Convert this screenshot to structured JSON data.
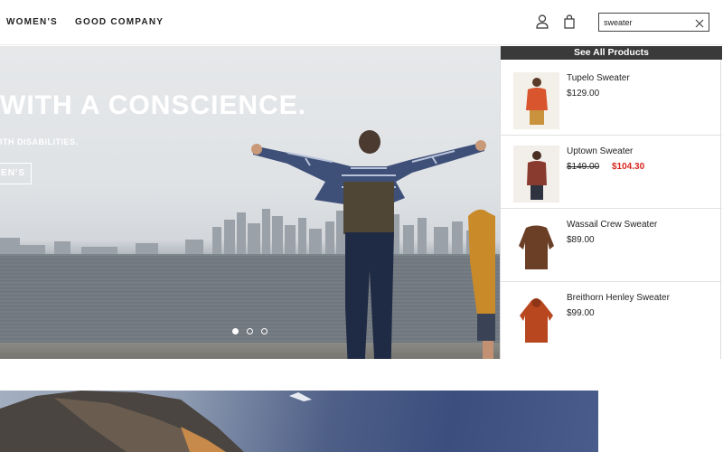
{
  "header": {
    "nav": [
      "WOMEN'S",
      "GOOD COMPANY"
    ],
    "search": {
      "value": "sweater",
      "placeholder": ""
    },
    "icons": [
      "user-icon",
      "shopping-bag-icon",
      "close-icon"
    ]
  },
  "hero": {
    "headline": "WITH A CONSCIENCE.",
    "subtext": "ITH DISABILITIES.",
    "cta": "EN'S",
    "slides": {
      "count": 3,
      "active": 1
    }
  },
  "dropdown": {
    "see_all": "See All Products",
    "products": [
      {
        "name": "Tupelo Sweater",
        "price": "$129.00",
        "color": "#d9552e"
      },
      {
        "name": "Uptown Sweater",
        "price_original": "$149.00",
        "price_sale": "$104.30",
        "color": "#8a3b2f"
      },
      {
        "name": "Wassail Crew Sweater",
        "price": "$89.00",
        "color": "#6b3f26"
      },
      {
        "name": "Breithorn Henley Sweater",
        "price": "$99.00",
        "color": "#b8471f"
      }
    ]
  },
  "colors": {
    "accent_sale": "#d8261d",
    "see_all_bg": "#3a3a3a"
  }
}
